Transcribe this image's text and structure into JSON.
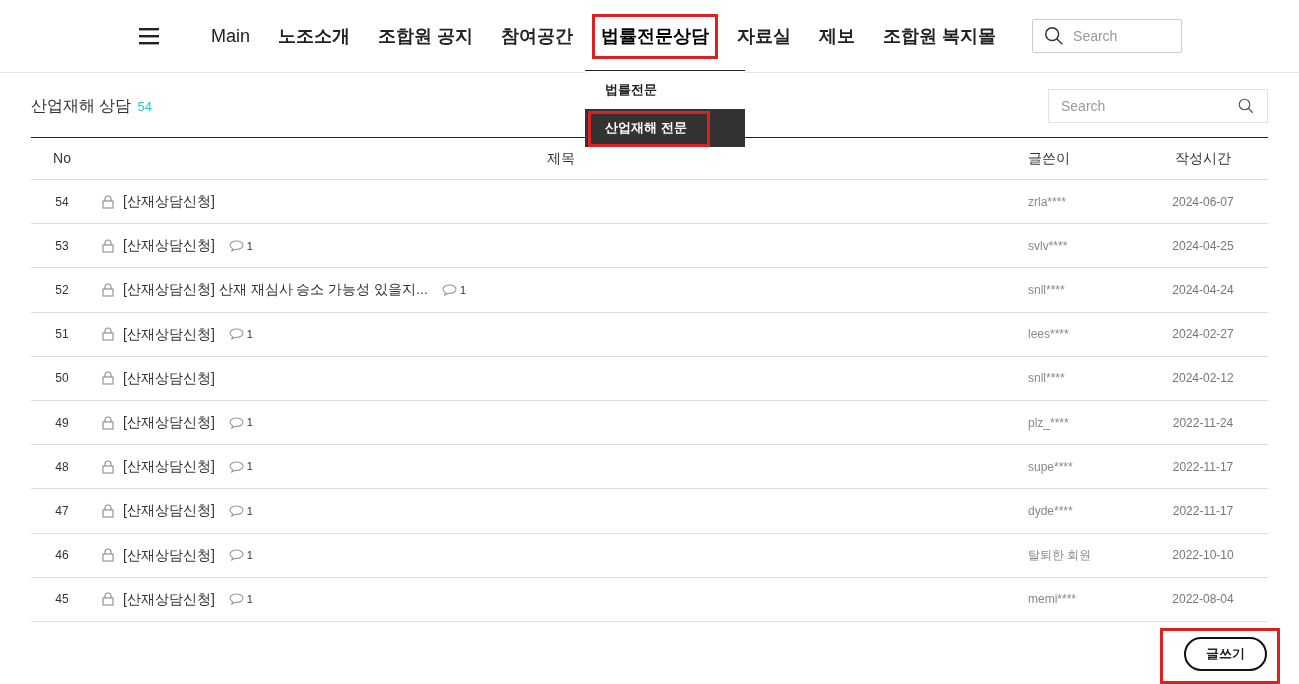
{
  "nav": {
    "items": [
      {
        "label": "Main",
        "selected": false,
        "highlighted": false
      },
      {
        "label": "노조소개",
        "selected": false,
        "highlighted": false
      },
      {
        "label": "조합원 공지",
        "selected": false,
        "highlighted": false
      },
      {
        "label": "참여공간",
        "selected": false,
        "highlighted": false
      },
      {
        "label": "법률전문상담",
        "selected": true,
        "highlighted": true
      },
      {
        "label": "자료실",
        "selected": false,
        "highlighted": false
      },
      {
        "label": "제보",
        "selected": false,
        "highlighted": false
      },
      {
        "label": "조합원 복지몰",
        "selected": false,
        "highlighted": false
      }
    ],
    "search": {
      "placeholder": "Search"
    },
    "dropdown": [
      {
        "label": "법률전문",
        "selected": false,
        "highlighted": false
      },
      {
        "label": "산업재해 전문",
        "selected": true,
        "highlighted": true
      }
    ]
  },
  "board": {
    "title": "산업재해 상담",
    "count": "54",
    "search": {
      "placeholder": "Search"
    },
    "columns": [
      "No",
      "제목",
      "글쓴이",
      "작성시간"
    ],
    "rows": [
      {
        "no": "54",
        "title": "[산재상담신청]",
        "locked": true,
        "comments": null,
        "writer": "zrla****",
        "date": "2024-06-07"
      },
      {
        "no": "53",
        "title": "[산재상담신청]",
        "locked": true,
        "comments": "1",
        "writer": "svlv****",
        "date": "2024-04-25"
      },
      {
        "no": "52",
        "title": "[산재상담신청] 산재 재심사 승소 가능성 있을지...",
        "locked": true,
        "comments": "1",
        "writer": "snll****",
        "date": "2024-04-24"
      },
      {
        "no": "51",
        "title": "[산재상담신청]",
        "locked": true,
        "comments": "1",
        "writer": "lees****",
        "date": "2024-02-27"
      },
      {
        "no": "50",
        "title": "[산재상담신청]",
        "locked": true,
        "comments": null,
        "writer": "snll****",
        "date": "2024-02-12"
      },
      {
        "no": "49",
        "title": "[산재상담신청]",
        "locked": true,
        "comments": "1",
        "writer": "plz_****",
        "date": "2022-11-24"
      },
      {
        "no": "48",
        "title": "[산재상담신청]",
        "locked": true,
        "comments": "1",
        "writer": "supe****",
        "date": "2022-11-17"
      },
      {
        "no": "47",
        "title": "[산재상담신청]",
        "locked": true,
        "comments": "1",
        "writer": "dyde****",
        "date": "2022-11-17"
      },
      {
        "no": "46",
        "title": "[산재상담신청]",
        "locked": true,
        "comments": "1",
        "writer": "탈퇴한 회원",
        "date": "2022-10-10"
      },
      {
        "no": "45",
        "title": "[산재상담신청]",
        "locked": true,
        "comments": "1",
        "writer": "memi****",
        "date": "2022-08-04"
      }
    ],
    "write_button": {
      "label": "글쓰기",
      "highlighted": true
    }
  }
}
